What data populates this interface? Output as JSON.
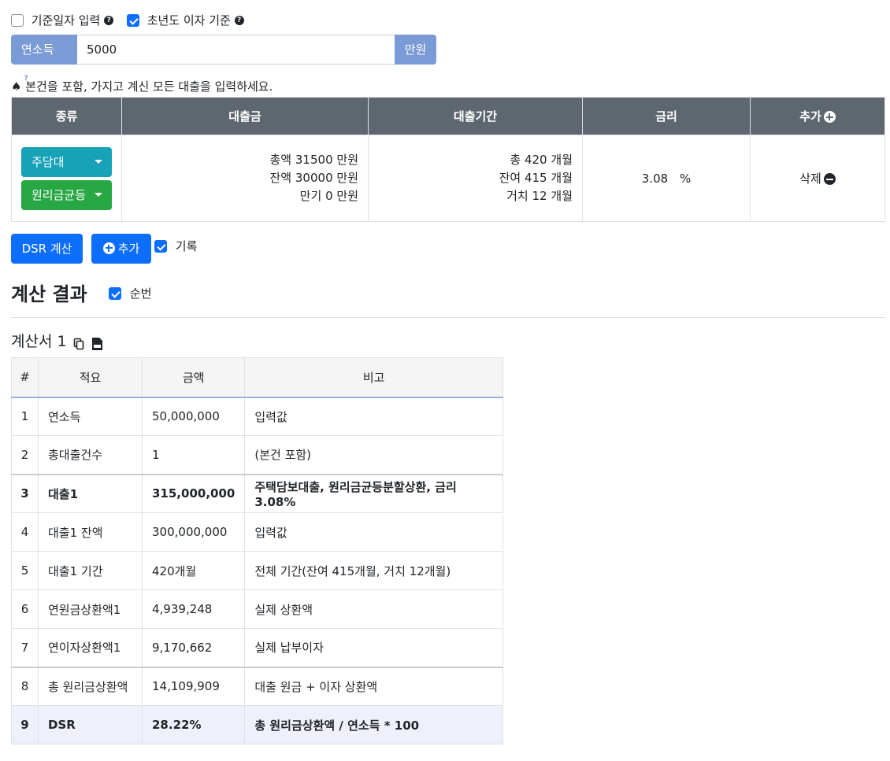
{
  "options": {
    "base_date_label": "기준일자 입력",
    "base_date_checked": false,
    "first_year_interest_label": "초년도 이자 기준",
    "first_year_interest_checked": true
  },
  "income": {
    "label": "연소득",
    "value": "5000",
    "unit": "만원"
  },
  "notice": "♠ 본건을 포함, 가지고 계신 모든 대출을 입력하세요.",
  "loan_table": {
    "headers": {
      "type": "종류",
      "amount": "대출금",
      "period": "대출기간",
      "rate": "금리",
      "add": "추가"
    },
    "rows": [
      {
        "loan_type": "주담대",
        "repay_type": "원리금균등",
        "total_label": "총액",
        "total_value": "31500",
        "balance_label": "잔액",
        "balance_value": "30000",
        "maturity_label": "만기",
        "maturity_value": "0",
        "amount_unit": "만원",
        "period_total_label": "총",
        "period_total_value": "420",
        "period_remain_label": "잔여",
        "period_remain_value": "415",
        "period_grace_label": "거치",
        "period_grace_value": "12",
        "period_unit": "개월",
        "rate_value": "3.08",
        "rate_unit": "%",
        "delete_label": "삭제"
      }
    ]
  },
  "actions": {
    "calc_label": "DSR 계산",
    "add_label": "추가",
    "record_label": "기록",
    "record_checked": true
  },
  "result": {
    "title": "계산 결과",
    "order_label": "순번",
    "order_checked": true,
    "sheet_title": "계산서 1",
    "headers": {
      "no": "#",
      "item": "적요",
      "amount": "금액",
      "note": "비고"
    },
    "rows": [
      {
        "no": "1",
        "item": "연소득",
        "amount": "50,000,000",
        "note": "입력값"
      },
      {
        "no": "2",
        "item": "총대출건수",
        "amount": "1",
        "note": "(본건 포함)"
      },
      {
        "no": "3",
        "item": "대출1",
        "amount": "315,000,000",
        "note": "주택담보대출, 원리금균등분할상환, 금리 3.08%"
      },
      {
        "no": "4",
        "item": "대출1 잔액",
        "amount": "300,000,000",
        "note": "입력값"
      },
      {
        "no": "5",
        "item": "대출1 기간",
        "amount": "420개월",
        "note": "전체 기간(잔여 415개월, 거치 12개월)"
      },
      {
        "no": "6",
        "item": "연원금상환액1",
        "amount": "4,939,248",
        "note": "실제 상환액"
      },
      {
        "no": "7",
        "item": "연이자상환액1",
        "amount": "9,170,662",
        "note": "실제 납부이자"
      },
      {
        "no": "8",
        "item": "총 원리금상환액",
        "amount": "14,109,909",
        "note": "대출 원금 + 이자 상환액"
      },
      {
        "no": "9",
        "item": "DSR",
        "amount": "28.22%",
        "note": "총 원리금상환액 / 연소득 * 100"
      }
    ]
  },
  "colors": {
    "primary": "#0d6efd",
    "teal": "#17a2b8",
    "green": "#28a745",
    "header_gray": "#5e666f",
    "addon_blue": "#7b9bd6"
  }
}
